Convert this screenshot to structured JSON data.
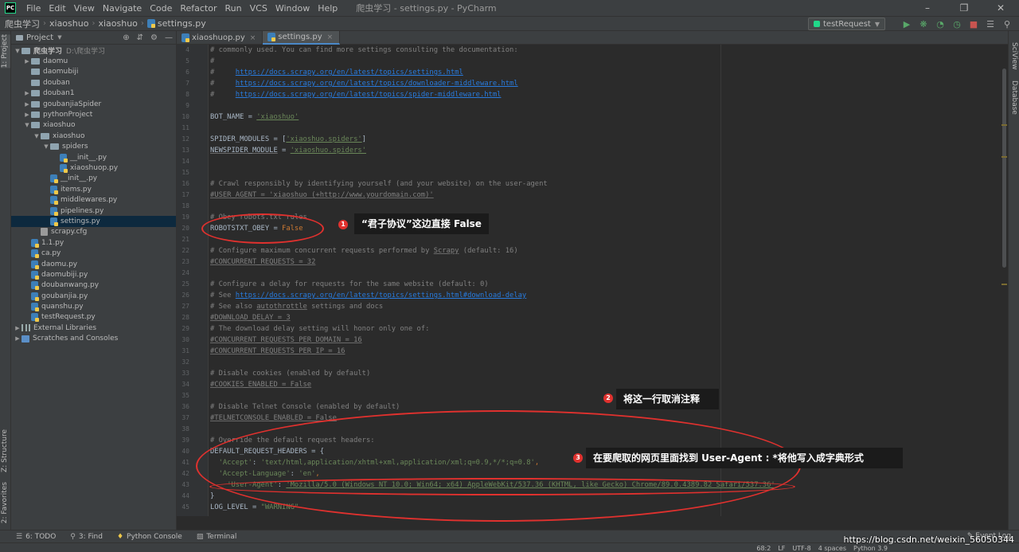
{
  "app": {
    "icon_text": "PC",
    "window_title": "爬虫学习 - settings.py - PyCharm",
    "menu": [
      "File",
      "Edit",
      "View",
      "Navigate",
      "Code",
      "Refactor",
      "Run",
      "VCS",
      "Window",
      "Help"
    ]
  },
  "navbar": {
    "crumbs": [
      "爬虫学习",
      "xiaoshuo",
      "xiaoshuo",
      "settings.py"
    ],
    "run_config": "testRequest"
  },
  "project": {
    "title": "Project",
    "tree": [
      {
        "label": "爬虫学习",
        "hint": "D:\\爬虫学习",
        "depth": 0,
        "kind": "folder",
        "open": true
      },
      {
        "label": "daomu",
        "depth": 1,
        "kind": "folder",
        "open": false
      },
      {
        "label": "daomubiji",
        "depth": 1,
        "kind": "folder",
        "leaf": true
      },
      {
        "label": "douban",
        "depth": 1,
        "kind": "folder",
        "leaf": true
      },
      {
        "label": "douban1",
        "depth": 1,
        "kind": "folder",
        "open": false
      },
      {
        "label": "goubanjiaSpider",
        "depth": 1,
        "kind": "folder",
        "open": false
      },
      {
        "label": "pythonProject",
        "depth": 1,
        "kind": "folder",
        "open": false
      },
      {
        "label": "xiaoshuo",
        "depth": 1,
        "kind": "folder",
        "open": true
      },
      {
        "label": "xiaoshuo",
        "depth": 2,
        "kind": "folder",
        "open": true
      },
      {
        "label": "spiders",
        "depth": 3,
        "kind": "folder",
        "open": true
      },
      {
        "label": "__init__.py",
        "depth": 4,
        "kind": "py"
      },
      {
        "label": "xiaoshuop.py",
        "depth": 4,
        "kind": "py"
      },
      {
        "label": "__init__.py",
        "depth": 3,
        "kind": "py"
      },
      {
        "label": "items.py",
        "depth": 3,
        "kind": "py"
      },
      {
        "label": "middlewares.py",
        "depth": 3,
        "kind": "py"
      },
      {
        "label": "pipelines.py",
        "depth": 3,
        "kind": "py"
      },
      {
        "label": "settings.py",
        "depth": 3,
        "kind": "py",
        "selected": true
      },
      {
        "label": "scrapy.cfg",
        "depth": 2,
        "kind": "cfg"
      },
      {
        "label": "1.1.py",
        "depth": 1,
        "kind": "py"
      },
      {
        "label": "ca.py",
        "depth": 1,
        "kind": "py"
      },
      {
        "label": "daomu.py",
        "depth": 1,
        "kind": "py"
      },
      {
        "label": "daomubiji.py",
        "depth": 1,
        "kind": "py"
      },
      {
        "label": "doubanwang.py",
        "depth": 1,
        "kind": "py"
      },
      {
        "label": "goubanjia.py",
        "depth": 1,
        "kind": "py"
      },
      {
        "label": "quanshu.py",
        "depth": 1,
        "kind": "py"
      },
      {
        "label": "testRequest.py",
        "depth": 1,
        "kind": "py"
      },
      {
        "label": "External Libraries",
        "depth": 0,
        "kind": "lib",
        "open": false
      },
      {
        "label": "Scratches and Consoles",
        "depth": 0,
        "kind": "scratch",
        "open": false
      }
    ]
  },
  "left_strip": {
    "project_tab": "1: Project",
    "structure_tab": "Z: Structure",
    "favorites_tab": "2: Favorites"
  },
  "right_strip": {
    "sciview_tab": "SciView",
    "database_tab": "Database"
  },
  "editor_tabs": [
    {
      "label": "xiaoshuop.py",
      "active": false
    },
    {
      "label": "settings.py",
      "active": true
    }
  ],
  "code_lines": [
    {
      "n": "4",
      "parts": [
        [
          "c-com",
          "# commonly used. You can find more settings consulting the documentation:"
        ]
      ]
    },
    {
      "n": "5",
      "parts": [
        [
          "c-com",
          "#"
        ]
      ]
    },
    {
      "n": "6",
      "parts": [
        [
          "c-com",
          "#     "
        ],
        [
          "c-url",
          "https://docs.scrapy.org/en/latest/topics/settings.html"
        ]
      ]
    },
    {
      "n": "7",
      "parts": [
        [
          "c-com",
          "#     "
        ],
        [
          "c-url",
          "https://docs.scrapy.org/en/latest/topics/downloader-middleware.html"
        ]
      ]
    },
    {
      "n": "8",
      "parts": [
        [
          "c-com",
          "#     "
        ],
        [
          "c-url",
          "https://docs.scrapy.org/en/latest/topics/spider-middleware.html"
        ]
      ]
    },
    {
      "n": "9",
      "parts": []
    },
    {
      "n": "10",
      "parts": [
        [
          "",
          "BOT_NAME = "
        ],
        [
          "c-str c-green-under",
          "'xiaoshuo'"
        ]
      ]
    },
    {
      "n": "11",
      "parts": []
    },
    {
      "n": "12",
      "parts": [
        [
          "",
          "SPIDER_MODULES = ["
        ],
        [
          "c-str c-green-under",
          "'xiaoshuo.spiders'"
        ],
        [
          "",
          "]"
        ]
      ]
    },
    {
      "n": "13",
      "parts": [
        [
          "c-under",
          "NEWSPIDER_MODULE"
        ],
        [
          "",
          " = "
        ],
        [
          "c-str c-green-under",
          "'xiaoshuo.spiders'"
        ]
      ]
    },
    {
      "n": "14",
      "parts": []
    },
    {
      "n": "15",
      "parts": []
    },
    {
      "n": "16",
      "parts": [
        [
          "c-com",
          "# Crawl responsibly by identifying yourself (and your website) on the user-agent"
        ]
      ]
    },
    {
      "n": "17",
      "parts": [
        [
          "c-com c-under",
          "#USER_AGENT = 'xiaoshuo (+http://www.yourdomain.com)'"
        ]
      ]
    },
    {
      "n": "18",
      "parts": []
    },
    {
      "n": "19",
      "parts": [
        [
          "c-com",
          "# Obey robots.txt rules"
        ]
      ]
    },
    {
      "n": "20",
      "parts": [
        [
          "",
          "ROBOTSTXT_OBEY = "
        ],
        [
          "c-kw",
          "False"
        ]
      ]
    },
    {
      "n": "21",
      "parts": []
    },
    {
      "n": "22",
      "parts": [
        [
          "c-com",
          "# Configure maximum concurrent requests performed by "
        ],
        [
          "c-com c-under",
          "Scrapy"
        ],
        [
          "c-com",
          " (default: 16)"
        ]
      ]
    },
    {
      "n": "23",
      "parts": [
        [
          "c-com c-under",
          "#CONCURRENT_REQUESTS = 32"
        ]
      ]
    },
    {
      "n": "24",
      "parts": []
    },
    {
      "n": "25",
      "parts": [
        [
          "c-com",
          "# Configure a delay for requests for the same website (default: 0)"
        ]
      ]
    },
    {
      "n": "26",
      "parts": [
        [
          "c-com",
          "# See "
        ],
        [
          "c-url",
          "https://docs.scrapy.org/en/latest/topics/settings.html#download-delay"
        ]
      ]
    },
    {
      "n": "27",
      "parts": [
        [
          "c-com",
          "# See also "
        ],
        [
          "c-com c-under",
          "autothrottle"
        ],
        [
          "c-com",
          " settings and docs"
        ]
      ]
    },
    {
      "n": "28",
      "parts": [
        [
          "c-com c-under",
          "#DOWNLOAD_DELAY = 3"
        ]
      ]
    },
    {
      "n": "29",
      "parts": [
        [
          "c-com",
          "# The download delay setting will honor only one of:"
        ]
      ]
    },
    {
      "n": "30",
      "parts": [
        [
          "c-com c-under",
          "#CONCURRENT_REQUESTS_PER_DOMAIN = 16"
        ]
      ]
    },
    {
      "n": "31",
      "parts": [
        [
          "c-com c-under",
          "#CONCURRENT_REQUESTS_PER_IP = 16"
        ]
      ]
    },
    {
      "n": "32",
      "parts": []
    },
    {
      "n": "33",
      "parts": [
        [
          "c-com",
          "# Disable cookies (enabled by default)"
        ]
      ]
    },
    {
      "n": "34",
      "parts": [
        [
          "c-com c-under",
          "#COOKIES_ENABLED = False"
        ]
      ]
    },
    {
      "n": "35",
      "parts": []
    },
    {
      "n": "36",
      "parts": [
        [
          "c-com",
          "# Disable Telnet Console (enabled by default)"
        ]
      ]
    },
    {
      "n": "37",
      "parts": [
        [
          "c-com c-under",
          "#TELNETCONSOLE_ENABLED = False"
        ]
      ]
    },
    {
      "n": "38",
      "parts": []
    },
    {
      "n": "39",
      "parts": [
        [
          "c-com",
          "# Override the default request headers:"
        ]
      ]
    },
    {
      "n": "40",
      "parts": [
        [
          "",
          "DEFAULT_REQUEST_HEADERS = {"
        ]
      ]
    },
    {
      "n": "41",
      "parts": [
        [
          "",
          "  "
        ],
        [
          "c-str",
          "'Accept'"
        ],
        [
          "",
          ": "
        ],
        [
          "c-str",
          "'text/html,application/xhtml+xml,application/xml;q=0.9,*/*;q=0.8'"
        ],
        [
          "c-kw",
          ","
        ]
      ]
    },
    {
      "n": "42",
      "parts": [
        [
          "",
          "  "
        ],
        [
          "c-str",
          "'Accept-Language'"
        ],
        [
          "",
          ": "
        ],
        [
          "c-str",
          "'en'"
        ],
        [
          "c-kw",
          ","
        ]
      ]
    },
    {
      "n": "43",
      "parts": [
        [
          "",
          "    "
        ],
        [
          "c-str",
          "'User-Agent'"
        ],
        [
          "",
          ": "
        ],
        [
          "c-str c-green-under",
          "'Mozilla/5.0 (Windows NT 10.0; Win64; x64) AppleWebKit/537.36 (KHTML, like Gecko) Chrome/89.0.4389.82 Safari/537.36'"
        ]
      ]
    },
    {
      "n": "44",
      "parts": [
        [
          "",
          "}"
        ]
      ]
    },
    {
      "n": "45",
      "parts": [
        [
          "",
          "LOG_LEVEL = "
        ],
        [
          "c-str",
          "\"WARNING\""
        ]
      ]
    }
  ],
  "annotations": {
    "n1": "1",
    "n2": "2",
    "n3": "3",
    "text1": "“君子协议”这边直接 False",
    "text2": "将这一行取消注释",
    "text3": "在要爬取的网页里面找到 User-Agent : *将他写入成字典形式"
  },
  "bottom_tabs": [
    "6: TODO",
    "3: Find",
    "Python Console",
    "Terminal"
  ],
  "event_log": "Event Log",
  "status": {
    "position": "68:2",
    "line_sep": "LF",
    "encoding": "UTF-8",
    "indent": "4 spaces",
    "interpreter": "Python 3.9"
  },
  "watermark": "https://blog.csdn.net/weixin_56050344",
  "colors": {
    "annotation_red": "#e0312e",
    "accent_blue": "#4a88c7",
    "editor_bg": "#2b2b2b"
  }
}
